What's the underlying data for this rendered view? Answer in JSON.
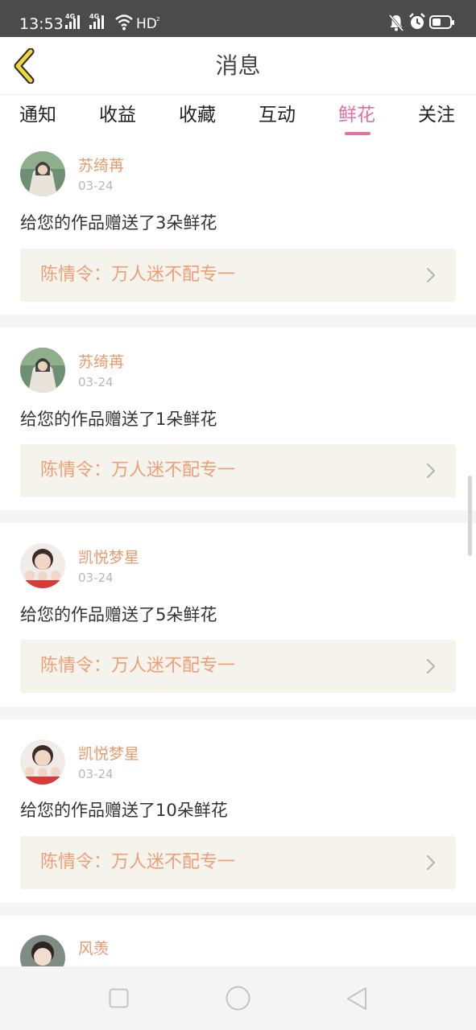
{
  "status_bar": {
    "time": "13:53",
    "signal1_label": "4G",
    "signal2_label": "4G",
    "hd_label": "HD",
    "hd_sub": "2"
  },
  "header": {
    "title": "消息",
    "back_icon": "chevron-left-icon",
    "back_color": "#f2d63a"
  },
  "tabs": [
    {
      "label": "通知",
      "active": false
    },
    {
      "label": "收益",
      "active": false
    },
    {
      "label": "收藏",
      "active": false
    },
    {
      "label": "互动",
      "active": false
    },
    {
      "label": "鲜花",
      "active": true
    },
    {
      "label": "关注",
      "active": false
    }
  ],
  "colors": {
    "accent_pink": "#e46da3",
    "username": "#ea9a6c",
    "work_title": "#ee9e76",
    "work_bg": "#f5f4ec"
  },
  "messages": [
    {
      "user": "苏绮苒",
      "date": "03-24",
      "text": "给您的作品赠送了3朵鲜花",
      "work": "陈情令：万人迷不配专一",
      "avatar": "user-avatar-photo"
    },
    {
      "user": "苏绮苒",
      "date": "03-24",
      "text": "给您的作品赠送了1朵鲜花",
      "work": "陈情令：万人迷不配专一",
      "avatar": "user-avatar-photo"
    },
    {
      "user": "凯悦梦星",
      "date": "03-24",
      "text": "给您的作品赠送了5朵鲜花",
      "work": "陈情令：万人迷不配专一",
      "avatar": "user-avatar-photo"
    },
    {
      "user": "凯悦梦星",
      "date": "03-24",
      "text": "给您的作品赠送了10朵鲜花",
      "work": "陈情令：万人迷不配专一",
      "avatar": "user-avatar-photo"
    },
    {
      "user": "风羡",
      "date": "",
      "text": "",
      "work": "",
      "avatar": "user-avatar-photo"
    }
  ],
  "nav_bar": {
    "recent_icon": "square-recents-icon",
    "home_icon": "circle-home-icon",
    "back_icon": "triangle-back-icon"
  }
}
